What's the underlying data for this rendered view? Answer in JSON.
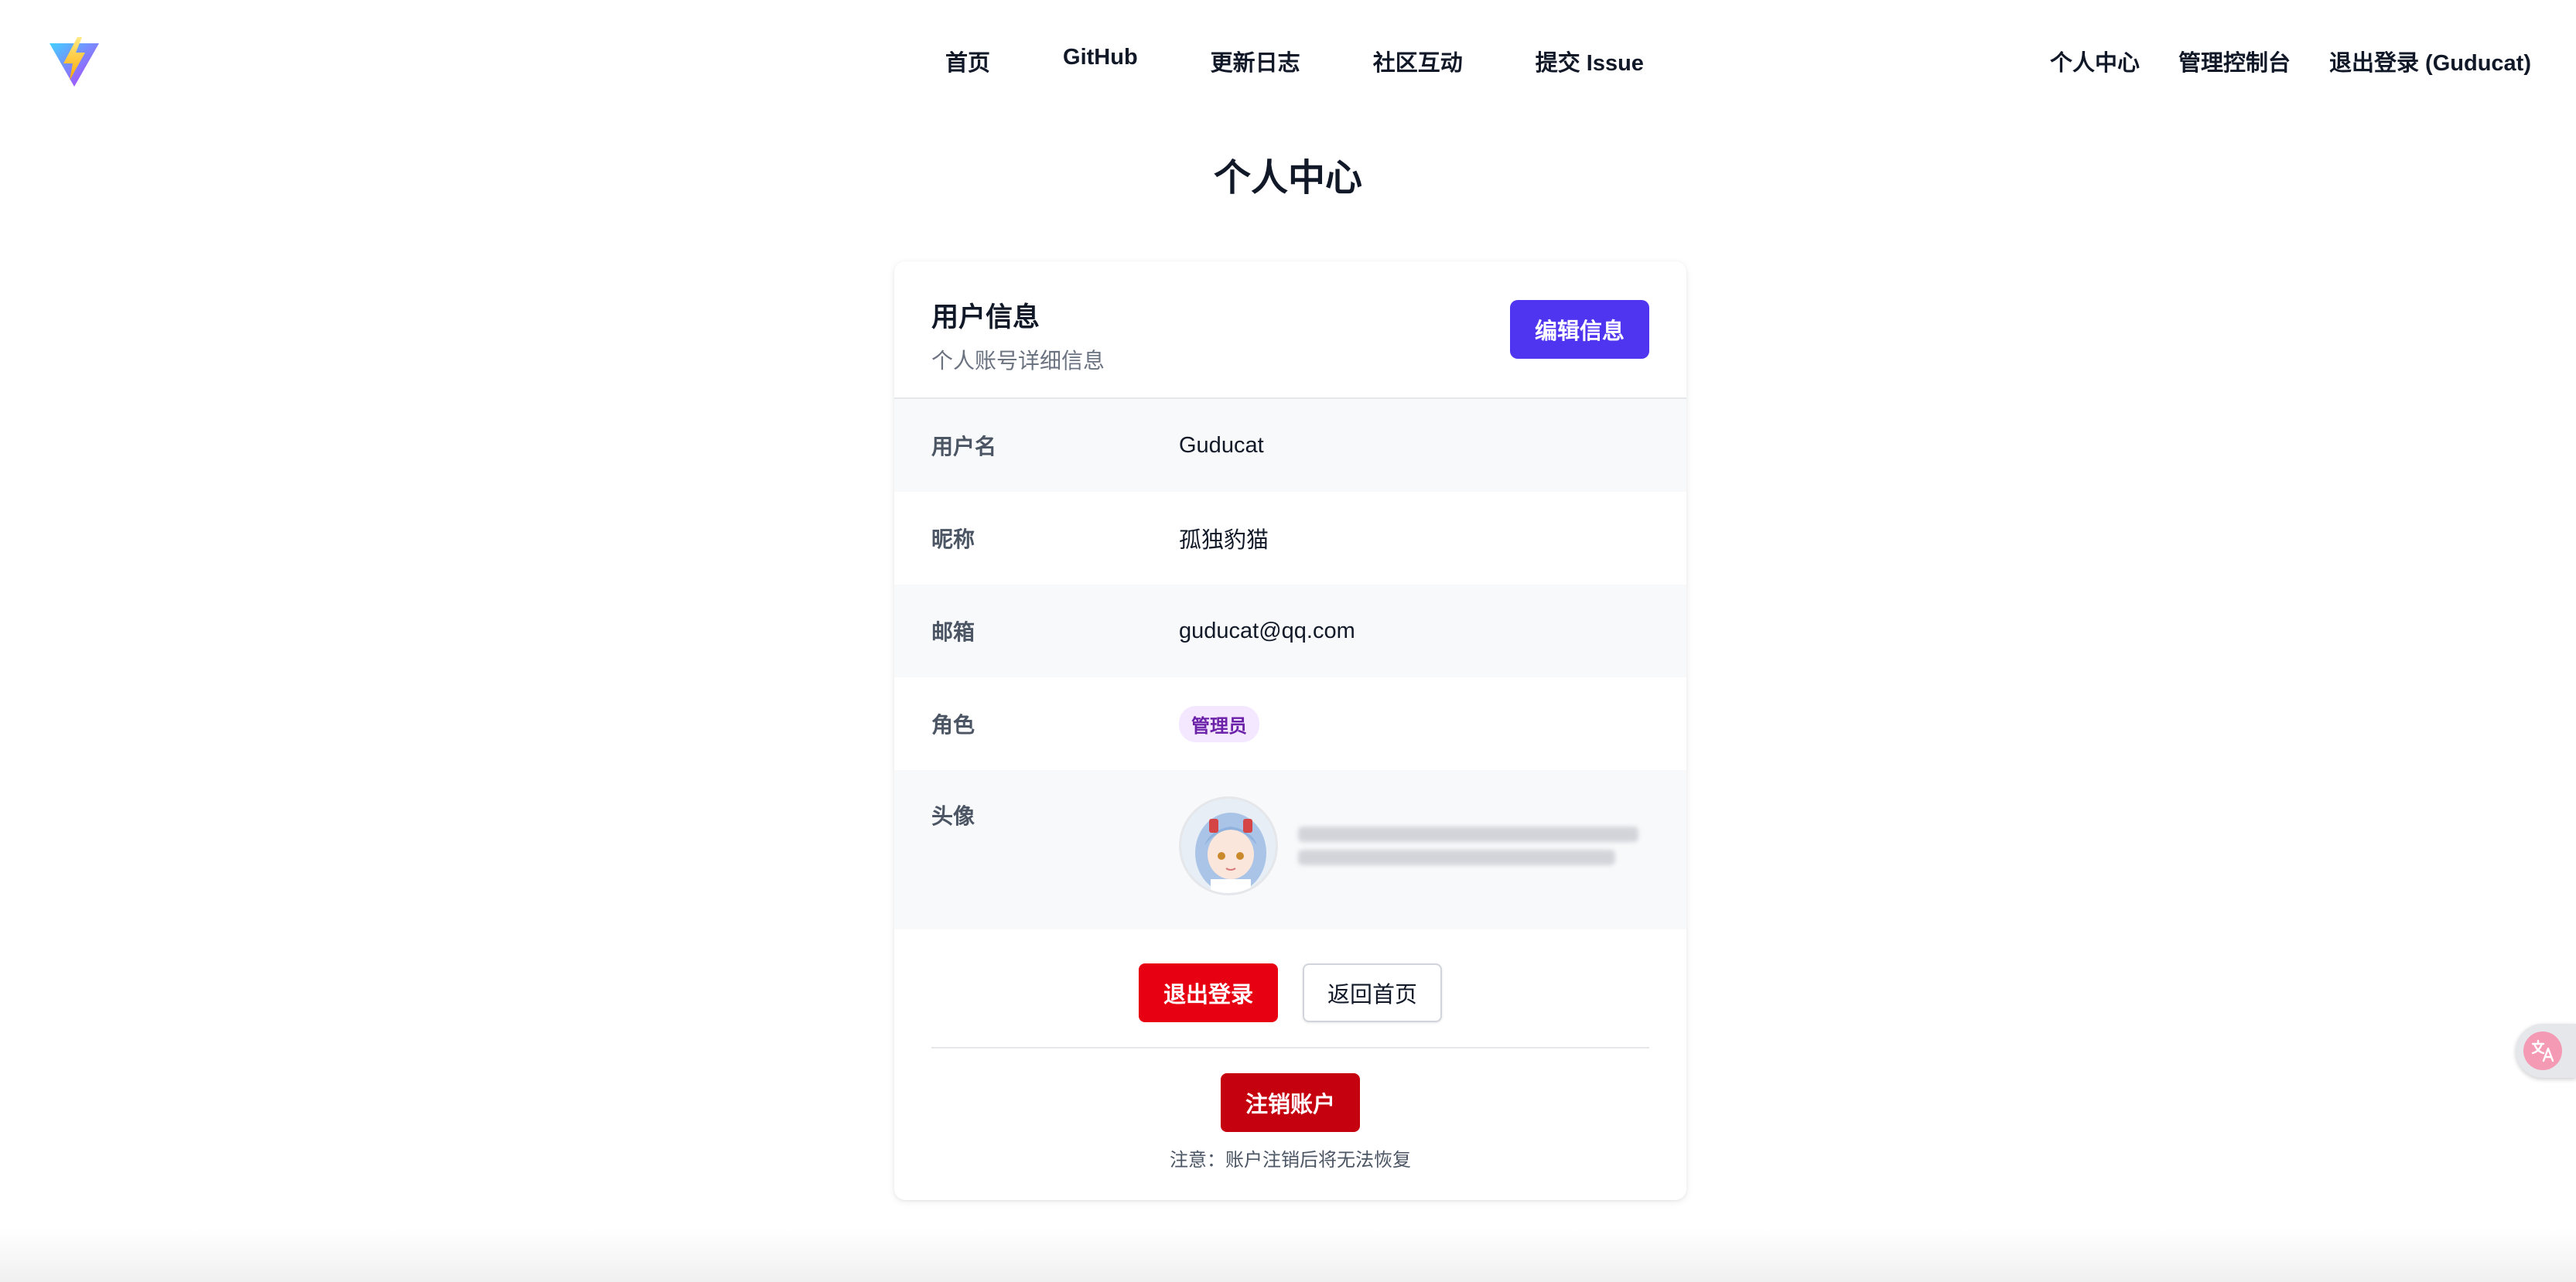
{
  "nav": {
    "center": [
      "首页",
      "GitHub",
      "更新日志",
      "社区互动",
      "提交 Issue"
    ],
    "right": [
      "个人中心",
      "管理控制台",
      "退出登录 (Guducat)"
    ]
  },
  "page_title": "个人中心",
  "card": {
    "title": "用户信息",
    "subtitle": "个人账号详细信息",
    "edit_button": "编辑信息",
    "rows": {
      "username": {
        "label": "用户名",
        "value": "Guducat"
      },
      "nickname": {
        "label": "昵称",
        "value": "孤独豹猫"
      },
      "email": {
        "label": "邮箱",
        "value": "guducat@qq.com"
      },
      "role": {
        "label": "角色",
        "value": "管理员"
      },
      "avatar": {
        "label": "头像"
      }
    },
    "logout_button": "退出登录",
    "home_button": "返回首页",
    "delete_button": "注销账户",
    "delete_note": "注意：账户注销后将无法恢复"
  },
  "floating_translate": {
    "icon": "translate-icon"
  },
  "colors": {
    "primary": "#4f35f0",
    "danger": "#e60012",
    "danger_dark": "#c5000f",
    "badge_bg": "#f3e8ff",
    "badge_text": "#6b21a8"
  }
}
